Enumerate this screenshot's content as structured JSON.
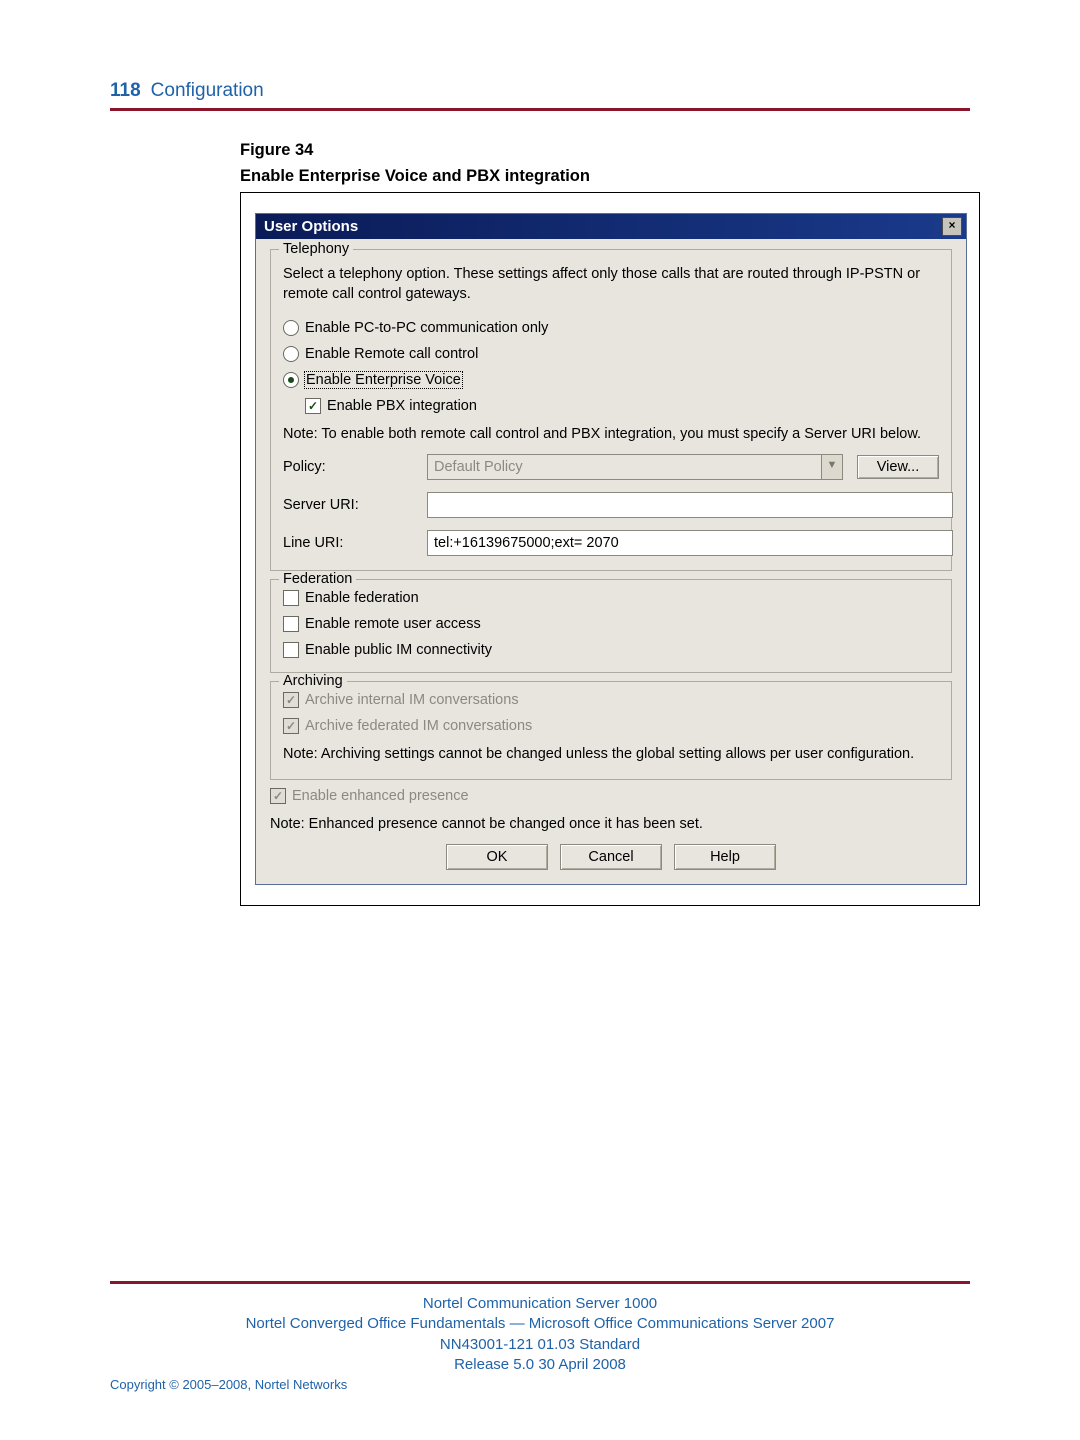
{
  "header": {
    "page_number": "118",
    "section": "Configuration"
  },
  "figure": {
    "label": "Figure 34",
    "title": "Enable Enterprise Voice and PBX integration"
  },
  "dialog": {
    "title": "User Options",
    "close_icon": "×",
    "telephony": {
      "legend": "Telephony",
      "description": "Select a telephony option. These settings affect only those calls that are routed through IP-PSTN or remote call control gateways.",
      "radio_pc": "Enable PC-to-PC communication only",
      "radio_remote": "Enable Remote call control",
      "radio_voice": "Enable Enterprise Voice",
      "check_pbx": "Enable PBX integration",
      "note": "Note: To enable both remote call control and PBX integration, you must specify a Server URI below.",
      "policy_label": "Policy:",
      "policy_value": "Default Policy",
      "view_btn": "View...",
      "server_uri_label": "Server URI:",
      "server_uri_value": "",
      "line_uri_label": "Line URI:",
      "line_uri_value": "tel:+16139675000;ext= 2070"
    },
    "federation": {
      "legend": "Federation",
      "check_fed": "Enable federation",
      "check_remote_user": "Enable remote user access",
      "check_public_im": "Enable public IM connectivity"
    },
    "archiving": {
      "legend": "Archiving",
      "check_internal": "Archive internal IM conversations",
      "check_federated": "Archive federated IM conversations",
      "note": "Note: Archiving settings cannot be changed unless the global setting allows per user configuration."
    },
    "presence": {
      "check_enhanced": "Enable enhanced presence",
      "note": "Note: Enhanced presence cannot be changed once it has been set."
    },
    "buttons": {
      "ok": "OK",
      "cancel": "Cancel",
      "help": "Help"
    }
  },
  "footer": {
    "line1": "Nortel Communication Server 1000",
    "line2": "Nortel Converged Office Fundamentals — Microsoft Office Communications Server 2007",
    "line3": "NN43001-121   01.03   Standard",
    "line4": "Release 5.0   30 April 2008",
    "copyright": "Copyright © 2005–2008, Nortel Networks"
  }
}
